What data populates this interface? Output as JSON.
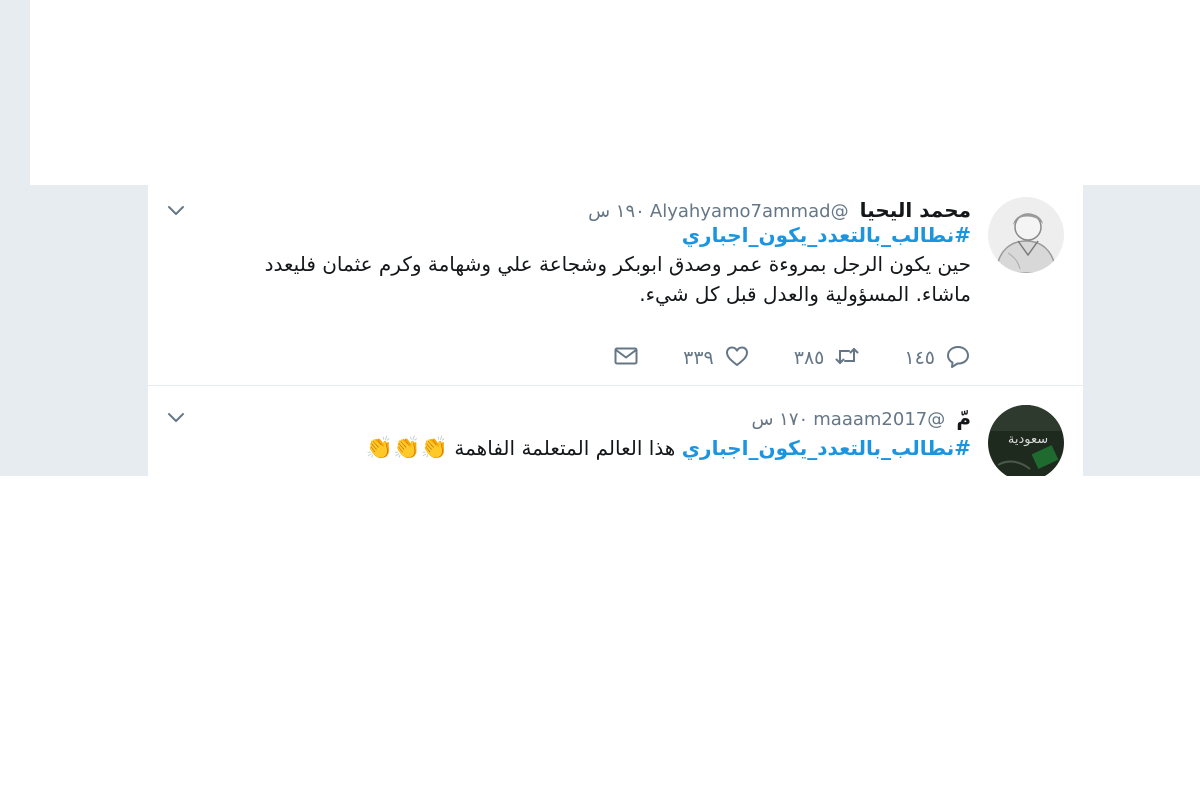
{
  "colors": {
    "background_gray": "#e6ecf0",
    "link_blue": "#1b95e0",
    "secondary_text": "#657786",
    "primary_text": "#14171a"
  },
  "tweets": [
    {
      "display_name": "محمد اليحيا",
      "handle": "@Alyahyamo7ammad",
      "time": "١٩٠ س",
      "hashtag": "#نطالب_بالتعدد_يكون_اجباري",
      "text_line1": "حين يكون الرجل بمروءة عمر وصدق ابوبكر وشجاعة علي وشهامة وكرم عثمان فليعدد",
      "text_line2": "ماشاء. المسؤولية والعدل قبل كل شيء.",
      "actions": {
        "reply_icon": "reply-icon",
        "reply_count": "١٤٥",
        "retweet_icon": "retweet-icon",
        "retweet_count": "٣٨٥",
        "like_icon": "heart-icon",
        "like_count": "٣٣٩",
        "dm_icon": "envelope-icon"
      }
    },
    {
      "display_name": "مّ",
      "handle": "@maaam2017",
      "time": "١٧٠ س",
      "hashtag": "#نطالب_بالتعدد_يكون_اجباري",
      "text": "هذا العالم المتعلمة الفاهمة",
      "emoji": "👏👏👏"
    }
  ]
}
